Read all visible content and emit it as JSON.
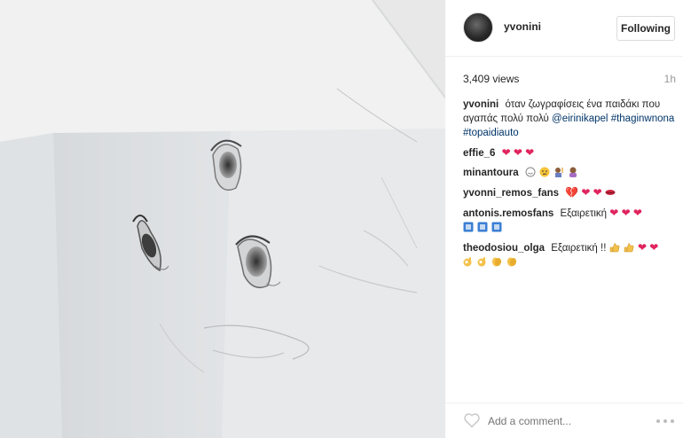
{
  "post": {
    "username": "yvonini",
    "follow_label": "Following",
    "views": "3,409 views",
    "time": "1h"
  },
  "caption": {
    "user": "yvonini",
    "text": "όταν ζωγραφίσεις ένα παιδάκι που αγαπάς πολύ πολύ",
    "mention": "@eirinikapel",
    "hashtags": "#thaginwnona #topaidiauto"
  },
  "comments": [
    {
      "user": "effie_6",
      "emojis": [
        "heart",
        "heart",
        "heart"
      ]
    },
    {
      "user": "minantoura",
      "emojis": [
        "smile-face",
        "confused-face",
        "raising-hand",
        "bowing-person"
      ]
    },
    {
      "user": "yvonni_remos_fans",
      "emojis": [
        "broken-heart",
        "heart",
        "heart",
        "lips"
      ]
    },
    {
      "user": "antonis.remosfans",
      "text": "Εξαιρετική",
      "emojis": [
        "heart",
        "heart",
        "heart",
        "blue-tile",
        "blue-tile",
        "blue-tile"
      ]
    },
    {
      "user": "theodosiou_olga",
      "text": "Εξαιρετική !!",
      "emojis": [
        "thumbs-up",
        "thumbs-up",
        "heart",
        "heart",
        "ok-hand",
        "ok-hand",
        "clap",
        "clap"
      ]
    }
  ],
  "composer": {
    "placeholder": "Add a comment...",
    "like_icon": "heart-outline-icon",
    "more_icon": "more-dots-icon"
  },
  "colors": {
    "heart": "#e0245e",
    "link": "#003569",
    "muted": "#999999"
  }
}
